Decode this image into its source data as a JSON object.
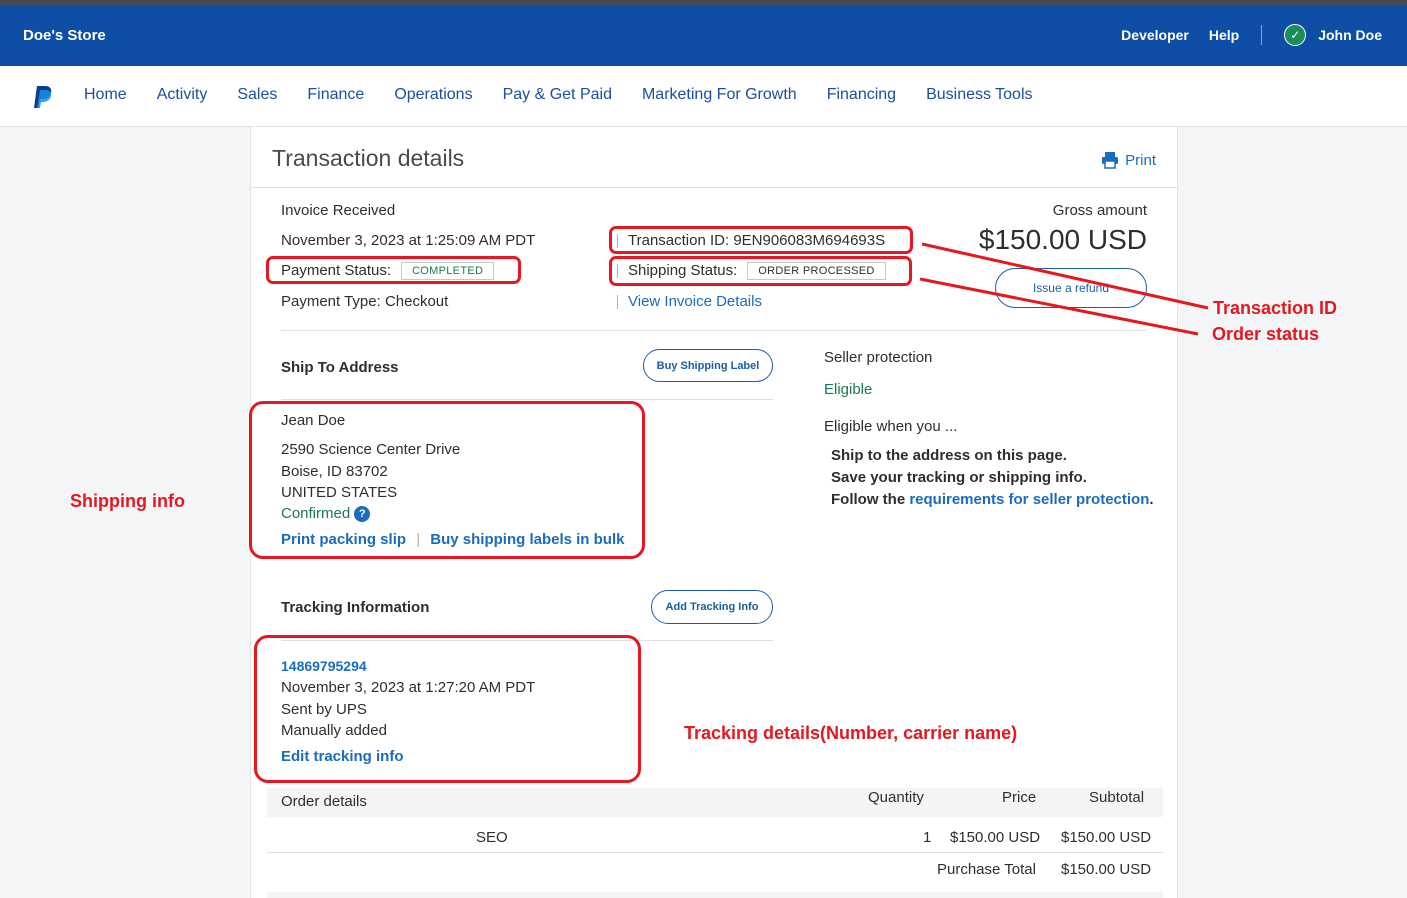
{
  "header": {
    "store_name": "Doe's Store",
    "developer": "Developer",
    "help": "Help",
    "user_name": "John Doe"
  },
  "nav": {
    "items": [
      "Home",
      "Activity",
      "Sales",
      "Finance",
      "Operations",
      "Pay & Get Paid",
      "Marketing For Growth",
      "Financing",
      "Business Tools"
    ]
  },
  "page": {
    "title": "Transaction details",
    "print": "Print"
  },
  "transaction": {
    "type": "Invoice Received",
    "date": "November 3, 2023 at 1:25:09 AM PDT",
    "payment_status_label": "Payment Status:",
    "payment_status": "COMPLETED",
    "payment_type": "Payment Type: Checkout",
    "transaction_id": "Transaction ID: 9EN906083M694693S",
    "shipping_status_label": "Shipping Status:",
    "shipping_status": "ORDER PROCESSED",
    "view_invoice": "View Invoice Details",
    "gross_label": "Gross amount",
    "gross_amount": "$150.00 USD",
    "issue_refund": "Issue a refund"
  },
  "ship_to": {
    "heading": "Ship To Address",
    "buy_label_button": "Buy Shipping Label",
    "name": "Jean Doe",
    "street": "2590 Science Center Drive",
    "city": "Boise, ID 83702",
    "country": "UNITED STATES",
    "confirmed": "Confirmed",
    "print_slip": "Print packing slip",
    "bulk_labels": "Buy shipping labels in bulk"
  },
  "seller_protection": {
    "heading": "Seller protection",
    "status": "Eligible",
    "when": "Eligible when you ...",
    "line1": "Ship to the address on this page.",
    "line2": "Save your tracking or shipping info.",
    "line3_prefix": "Follow the ",
    "line3_link": "requirements for seller protection",
    "line3_suffix": "."
  },
  "tracking": {
    "heading": "Tracking Information",
    "add_button": "Add Tracking Info",
    "number": "14869795294",
    "date": "November 3, 2023 at 1:27:20 AM PDT",
    "carrier": "Sent by UPS",
    "method": "Manually added",
    "edit": "Edit tracking info"
  },
  "order": {
    "heading": "Order details",
    "col_quantity": "Quantity",
    "col_price": "Price",
    "col_subtotal": "Subtotal",
    "items": [
      {
        "name": "SEO",
        "quantity": "1",
        "price": "$150.00 USD",
        "subtotal": "$150.00 USD"
      }
    ],
    "purchase_total_label": "Purchase Total",
    "purchase_total": "$150.00 USD"
  },
  "annotations": {
    "transaction_id": "Transaction ID",
    "order_status": "Order status",
    "shipping_info": "Shipping info",
    "tracking_details": "Tracking details(Number, carrier name)",
    "color": "#e4181e"
  }
}
